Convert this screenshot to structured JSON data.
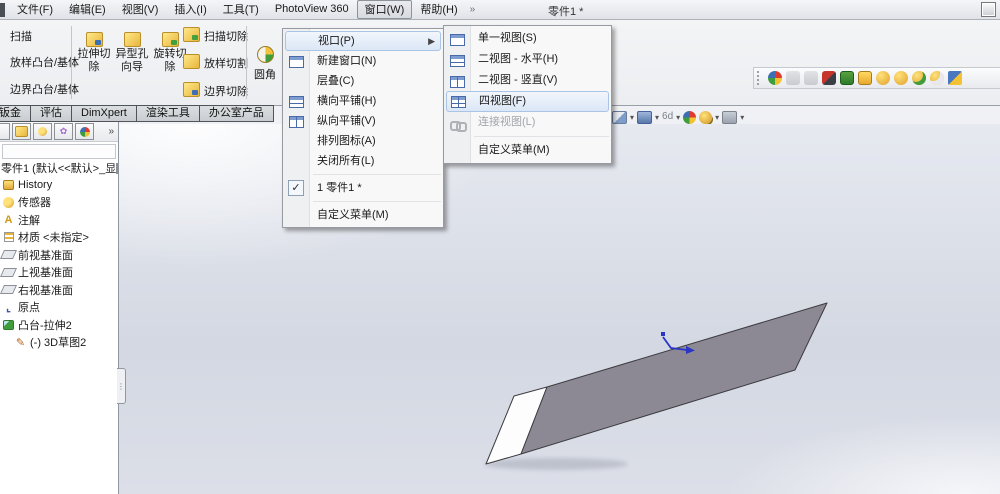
{
  "window": {
    "title": "零件1 *"
  },
  "menubar": {
    "items": [
      {
        "label": "文件(F)"
      },
      {
        "label": "编辑(E)"
      },
      {
        "label": "视图(V)"
      },
      {
        "label": "插入(I)"
      },
      {
        "label": "工具(T)"
      },
      {
        "label": "PhotoView 360"
      },
      {
        "label": "窗口(W)"
      },
      {
        "label": "帮助(H)"
      }
    ]
  },
  "toolbar": {
    "left_links": {
      "swept": "扫描",
      "loft": "放样凸台/基体",
      "boundary": "边界凸台/基体"
    },
    "big_buttons": {
      "extruded_cut": "拉伸切除",
      "hole_wizard": "异型孔向导",
      "revolved_cut": "旋转切除"
    },
    "cut_links": {
      "swept_cut": "扫描切除",
      "lofted_cut": "放样切割",
      "boundary_cut": "边界切除"
    },
    "fillet": "圆角"
  },
  "tabs": {
    "t0": "钣金",
    "t1": "评估",
    "t2": "DimXpert",
    "t3": "渲染工具",
    "t4": "办公室产品"
  },
  "window_menu": {
    "viewport": "视口(P)",
    "new_window": "新建窗口(N)",
    "cascade": "层叠(C)",
    "tile_horizontally": "横向平铺(H)",
    "tile_vertically": "纵向平铺(V)",
    "arrange_icons": "排列图标(A)",
    "close_all": "关闭所有(L)",
    "open_doc": "1 零件1 *",
    "customize_menu": "自定义菜单(M)"
  },
  "viewport_submenu": {
    "single_view": "单一视图(S)",
    "two_view_horizontal": "二视图 - 水平(H)",
    "two_view_vertical": "二视图 - 竖直(V)",
    "four_view": "四视图(F)",
    "linked_views": "连接视图(L)",
    "customize_menu": "自定义菜单(M)"
  },
  "feature_tree": {
    "title": "零件1 (默认<<默认>_显",
    "items": {
      "history": "History",
      "sensors": "传感器",
      "annotations": "注解",
      "material": "材质 <未指定>",
      "front_plane": "前视基准面",
      "top_plane": "上视基准面",
      "right_plane": "右视基准面",
      "origin": "原点",
      "boss_extrude": "凸台-拉伸2",
      "sketch3d": "(-) 3D草图2"
    }
  },
  "glyphs": {
    "pin": "»",
    "more": "»",
    "dropdown": "▼",
    "submenu_arrow": "▶",
    "overflow_dash": "▾",
    "eyeglasses": "6d"
  },
  "colors": {
    "model_face": "#8d8994",
    "model_end_face": "#fdfdfd",
    "model_edge": "#3c3c40",
    "triad_blue": "#2a35c8",
    "menu_highlight_border": "#a9c4e4",
    "viewport_top": "#fbfbfc",
    "viewport_mid": "#d3d8e2"
  }
}
